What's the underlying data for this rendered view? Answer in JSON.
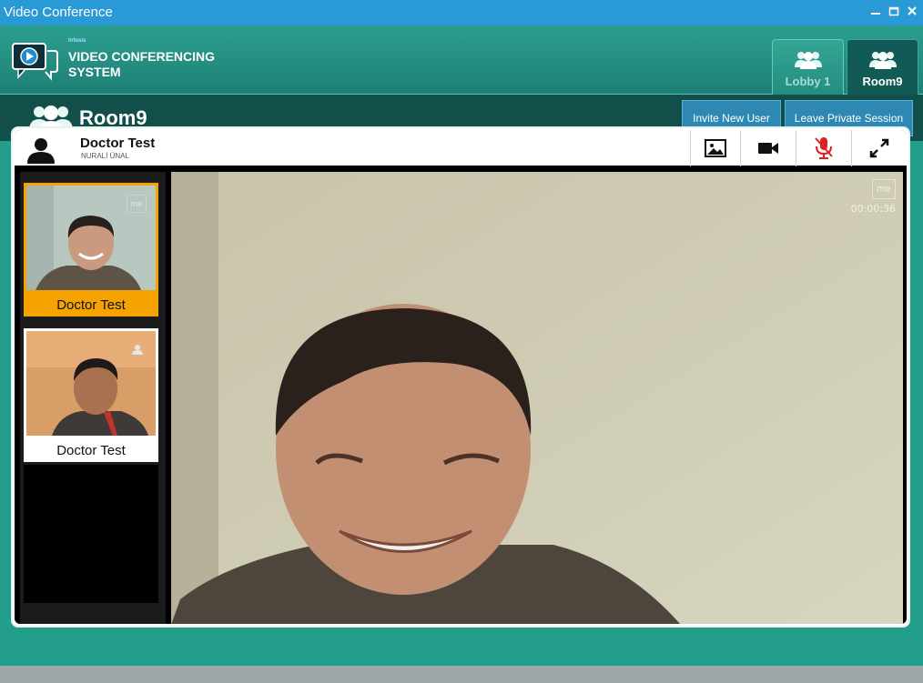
{
  "window": {
    "title": "Video Conference"
  },
  "header": {
    "brand_small": "Infosis",
    "brand_line1": "VIDEO CONFERENCING",
    "brand_line2": "SYSTEM",
    "tabs": [
      {
        "label": "Lobby 1",
        "active": false
      },
      {
        "label": "Room9",
        "active": true
      }
    ]
  },
  "room": {
    "title": "Room9",
    "invite_label": "Invite New User",
    "leave_label": "Leave Private Session"
  },
  "current_user": {
    "name": "Doctor Test",
    "subtitle": "NURALİ ÜNAL"
  },
  "toolbar": {
    "icons": [
      "image-icon",
      "video-camera-icon",
      "microphone-muted-icon",
      "fullscreen-icon"
    ],
    "mute_color": "#e02020"
  },
  "participants": [
    {
      "name": "Doctor Test",
      "badge": "me",
      "selected": true
    },
    {
      "name": "Doctor Test",
      "badge": "user-icon",
      "selected": false
    }
  ],
  "main_video": {
    "badge": "me",
    "timer": "00:00:36"
  },
  "colors": {
    "titlebar": "#2a9ad6",
    "app_bg": "#229e8b",
    "roombar": "#134f4a",
    "button": "#2d88b3",
    "selected_thumb": "#f5a300"
  }
}
